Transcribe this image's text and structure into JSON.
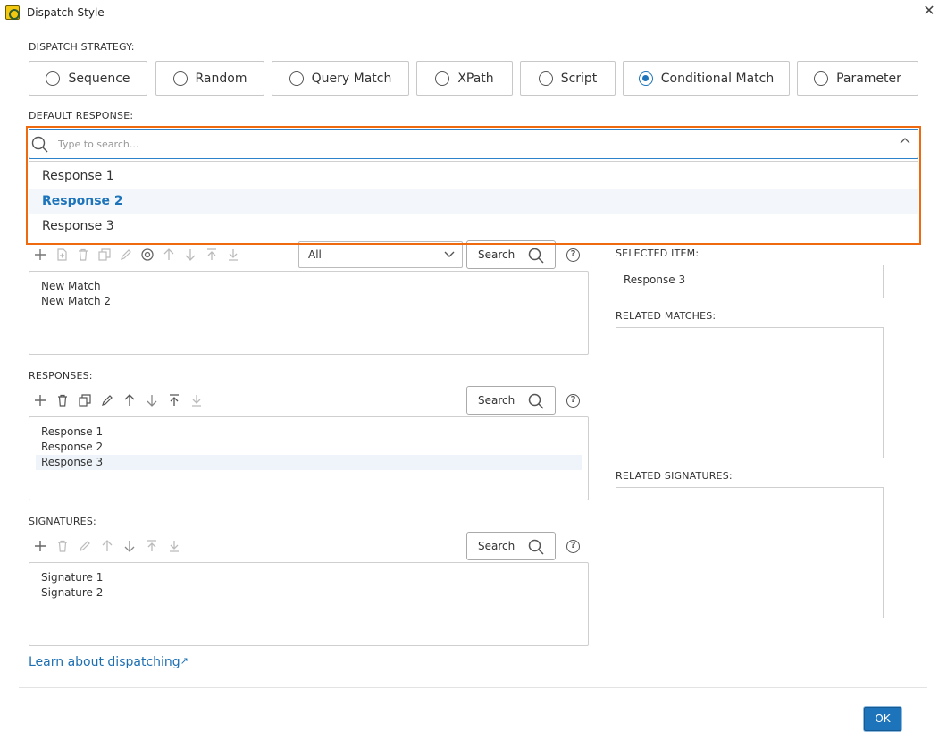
{
  "window": {
    "title": "Dispatch Style"
  },
  "dispatch": {
    "label": "DISPATCH STRATEGY:",
    "options": [
      {
        "label": "Sequence",
        "selected": false
      },
      {
        "label": "Random",
        "selected": false
      },
      {
        "label": "Query Match",
        "selected": false
      },
      {
        "label": "XPath",
        "selected": false
      },
      {
        "label": "Script",
        "selected": false
      },
      {
        "label": "Conditional Match",
        "selected": true
      },
      {
        "label": "Parameter",
        "selected": false
      }
    ]
  },
  "default_response": {
    "label": "DEFAULT RESPONSE:",
    "placeholder": "Type to search...",
    "value": "",
    "options": [
      "Response 1",
      "Response 2",
      "Response 3"
    ],
    "highlighted": "Response 2"
  },
  "matches": {
    "filter_value": "All",
    "search_label": "Search",
    "help": "?",
    "items": [
      "New Match",
      "New Match 2"
    ]
  },
  "responses": {
    "label": "RESPONSES:",
    "search_label": "Search",
    "help": "?",
    "items": [
      "Response 1",
      "Response 2",
      "Response 3"
    ],
    "selected": "Response 3"
  },
  "signatures": {
    "label": "SIGNATURES:",
    "search_label": "Search",
    "help": "?",
    "items": [
      "Signature 1",
      "Signature 2"
    ]
  },
  "side": {
    "selected_item_label": "SELECTED ITEM:",
    "selected_item_value": "Response 3",
    "related_matches_label": "RELATED MATCHES:",
    "related_signatures_label": "RELATED SIGNATURES:"
  },
  "footer": {
    "learn_link": "Learn about dispatching",
    "ok_label": "OK"
  },
  "colors": {
    "accent": "#1d74bb",
    "highlight_border": "#ef6a0f"
  }
}
